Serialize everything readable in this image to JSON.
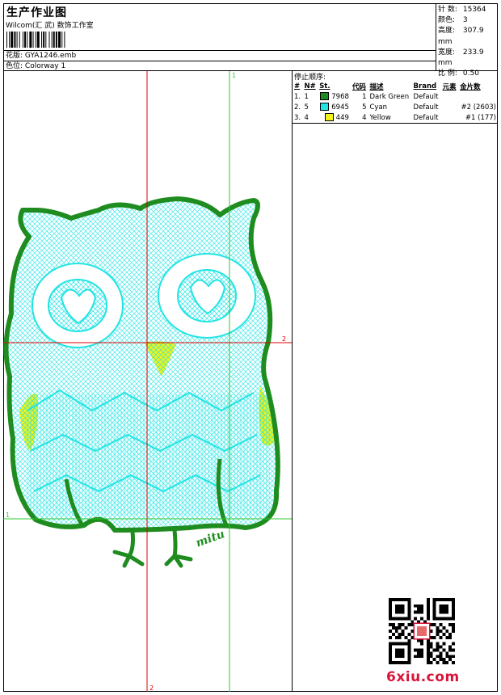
{
  "header": {
    "title": "生产作业图",
    "company": "Wilcom(汇 武) 数饰工作室",
    "filename_label": "花版:",
    "filename": "GYA1246.emb",
    "colorway_label": "色位:",
    "colorway": "Colorway 1"
  },
  "stats": [
    {
      "label": "针 数:",
      "value": "15364"
    },
    {
      "label": "颜色:",
      "value": "3"
    },
    {
      "label": "高度:",
      "value": "307.9 mm"
    },
    {
      "label": "宽度:",
      "value": "233.9 mm"
    },
    {
      "label": "比 例:",
      "value": "0.50"
    }
  ],
  "stop_sequence": {
    "title": "停止顺序:",
    "headers": [
      "#",
      "N#",
      "St.",
      "代码",
      "描述",
      "Brand",
      "元素",
      "金片数"
    ],
    "rows": [
      {
        "idx": "1.",
        "n": "1",
        "color": "#1e8c1e",
        "st": "7968",
        "code": "1",
        "desc": "Dark Green",
        "brand": "Default",
        "elem": "",
        "sequin": ""
      },
      {
        "idx": "2.",
        "n": "5",
        "color": "#22e4e4",
        "st": "6945",
        "code": "5",
        "desc": "Cyan",
        "brand": "Default",
        "elem": "",
        "sequin": "#2 (2603)"
      },
      {
        "idx": "3.",
        "n": "4",
        "color": "#f2f21a",
        "st": "449",
        "code": "4",
        "desc": "Yellow",
        "brand": "Default",
        "elem": "",
        "sequin": "#1 (177)"
      }
    ]
  },
  "guides": {
    "v1_label": "1",
    "v2_label": "2",
    "h1_label": "1",
    "h2_label": "2"
  },
  "colors": {
    "outline": "#1e8c1e",
    "fill": "#22e4e4",
    "accent": "#f2f21a",
    "guide_red": "#e00000",
    "guide_green": "#2ec82e"
  },
  "design": {
    "signature": "mitu"
  },
  "watermark": "6xiu.com"
}
